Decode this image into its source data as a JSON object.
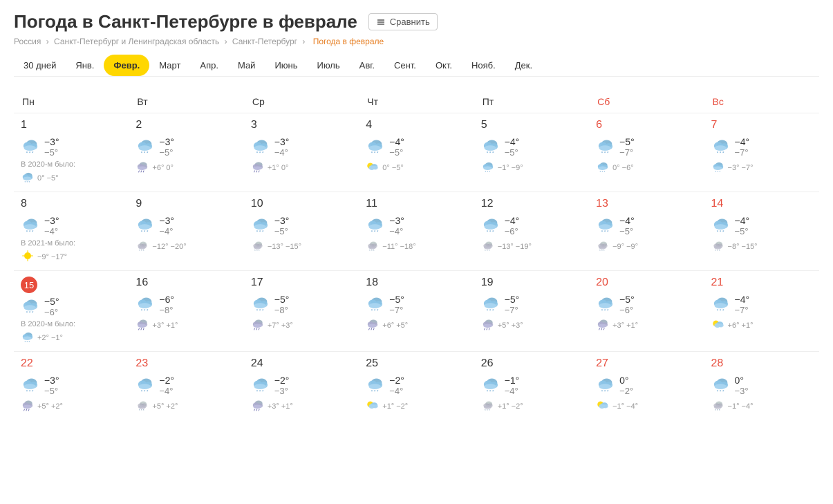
{
  "page": {
    "title": "Погода в Санкт-Петербурге в феврале",
    "compare_button": "Сравнить"
  },
  "breadcrumb": {
    "items": [
      "Россия",
      "Санкт-Петербург и Ленинградская область",
      "Санкт-Петербург"
    ],
    "current": "Погода в феврале"
  },
  "months": [
    {
      "label": "30 дней",
      "active": false
    },
    {
      "label": "Янв.",
      "active": false
    },
    {
      "label": "Февр.",
      "active": true
    },
    {
      "label": "Март",
      "active": false
    },
    {
      "label": "Апр.",
      "active": false
    },
    {
      "label": "Май",
      "active": false
    },
    {
      "label": "Июнь",
      "active": false
    },
    {
      "label": "Июль",
      "active": false
    },
    {
      "label": "Авг.",
      "active": false
    },
    {
      "label": "Сент.",
      "active": false
    },
    {
      "label": "Окт.",
      "active": false
    },
    {
      "label": "Нояб.",
      "active": false
    },
    {
      "label": "Дек.",
      "active": false
    }
  ],
  "weekdays": [
    {
      "label": "Пн",
      "weekend": false
    },
    {
      "label": "Вт",
      "weekend": false
    },
    {
      "label": "Ср",
      "weekend": false
    },
    {
      "label": "Чт",
      "weekend": false
    },
    {
      "label": "Пт",
      "weekend": false
    },
    {
      "label": "Сб",
      "weekend": true
    },
    {
      "label": "Вс",
      "weekend": true
    }
  ],
  "weeks": [
    {
      "days": [
        {
          "num": "1",
          "weekend": false,
          "icon": "snow-cloud",
          "high": "−3°",
          "low": "−5°",
          "was_label": "В 2020-м было:",
          "was_icon": "snow-cloud",
          "was_temps": "0° −5°"
        },
        {
          "num": "2",
          "weekend": false,
          "icon": "snow-cloud",
          "high": "−3°",
          "low": "−5°",
          "was_icon": "rain-cloud",
          "was_temps": "+6° 0°"
        },
        {
          "num": "3",
          "weekend": false,
          "icon": "snow-cloud",
          "high": "−3°",
          "low": "−4°",
          "was_icon": "rain-cloud",
          "was_temps": "+1° 0°"
        },
        {
          "num": "4",
          "weekend": false,
          "icon": "snow-cloud",
          "high": "−4°",
          "low": "−5°",
          "was_icon": "partly-sunny",
          "was_temps": "0° −5°"
        },
        {
          "num": "5",
          "weekend": false,
          "icon": "snow-cloud",
          "high": "−4°",
          "low": "−5°",
          "was_icon": "snow-cloud",
          "was_temps": "−1° −9°"
        },
        {
          "num": "6",
          "weekend": true,
          "icon": "snow-cloud",
          "high": "−5°",
          "low": "−7°",
          "was_icon": "snow-cloud",
          "was_temps": "0° −6°"
        },
        {
          "num": "7",
          "weekend": true,
          "icon": "snow-cloud",
          "high": "−4°",
          "low": "−7°",
          "was_icon": "snow-cloud",
          "was_temps": "−3° −7°"
        }
      ]
    },
    {
      "days": [
        {
          "num": "8",
          "weekend": false,
          "icon": "snow-cloud",
          "high": "−3°",
          "low": "−4°",
          "was_label": "В 2021-м было:",
          "was_icon": "sun",
          "was_temps": "−9° −17°"
        },
        {
          "num": "9",
          "weekend": false,
          "icon": "snow-cloud",
          "high": "−3°",
          "low": "−4°",
          "was_icon": "snow-cloud-small",
          "was_temps": "−12° −20°"
        },
        {
          "num": "10",
          "weekend": false,
          "icon": "snow-cloud",
          "high": "−3°",
          "low": "−5°",
          "was_icon": "snow-cloud-small",
          "was_temps": "−13° −15°"
        },
        {
          "num": "11",
          "weekend": false,
          "icon": "snow-cloud",
          "high": "−3°",
          "low": "−4°",
          "was_icon": "snow-cloud-small",
          "was_temps": "−11° −18°"
        },
        {
          "num": "12",
          "weekend": false,
          "icon": "snow-cloud",
          "high": "−4°",
          "low": "−6°",
          "was_icon": "snow-cloud-small",
          "was_temps": "−13° −19°"
        },
        {
          "num": "13",
          "weekend": true,
          "icon": "snow-cloud",
          "high": "−4°",
          "low": "−5°",
          "was_icon": "snow-cloud-small",
          "was_temps": "−9° −9°"
        },
        {
          "num": "14",
          "weekend": true,
          "icon": "snow-cloud",
          "high": "−4°",
          "low": "−5°",
          "was_icon": "snow-cloud-small",
          "was_temps": "−8° −15°"
        }
      ]
    },
    {
      "days": [
        {
          "num": "15",
          "weekend": false,
          "today": true,
          "icon": "snow-cloud",
          "high": "−5°",
          "low": "−6°",
          "was_label": "В 2020-м было:",
          "was_icon": "snow-cloud",
          "was_temps": "+2° −1°"
        },
        {
          "num": "16",
          "weekend": false,
          "icon": "snow-cloud",
          "high": "−6°",
          "low": "−8°",
          "was_icon": "rain-cloud",
          "was_temps": "+3° +1°"
        },
        {
          "num": "17",
          "weekend": false,
          "icon": "snow-cloud",
          "high": "−5°",
          "low": "−8°",
          "was_icon": "rain-cloud",
          "was_temps": "+7° +3°"
        },
        {
          "num": "18",
          "weekend": false,
          "icon": "snow-cloud",
          "high": "−5°",
          "low": "−7°",
          "was_icon": "rain-cloud",
          "was_temps": "+6° +5°"
        },
        {
          "num": "19",
          "weekend": false,
          "icon": "snow-cloud",
          "high": "−5°",
          "low": "−7°",
          "was_icon": "rain-cloud",
          "was_temps": "+5° +3°"
        },
        {
          "num": "20",
          "weekend": true,
          "icon": "snow-cloud",
          "high": "−5°",
          "low": "−6°",
          "was_icon": "rain-cloud",
          "was_temps": "+3° +1°"
        },
        {
          "num": "21",
          "weekend": true,
          "icon": "snow-cloud",
          "high": "−4°",
          "low": "−7°",
          "was_icon": "partly-sunny",
          "was_temps": "+6° +1°"
        }
      ]
    },
    {
      "days": [
        {
          "num": "22",
          "weekend": true,
          "icon": "snow-cloud",
          "high": "−3°",
          "low": "−5°",
          "was_icon": "rain-cloud",
          "was_temps": "+5° +2°"
        },
        {
          "num": "23",
          "weekend": true,
          "icon": "snow-cloud",
          "high": "−2°",
          "low": "−4°",
          "was_icon": "snow-cloud-small",
          "was_temps": "+5° +2°"
        },
        {
          "num": "24",
          "weekend": false,
          "icon": "snow-cloud",
          "high": "−2°",
          "low": "−3°",
          "was_icon": "rain-cloud",
          "was_temps": "+3° +1°"
        },
        {
          "num": "25",
          "weekend": false,
          "icon": "snow-cloud",
          "high": "−2°",
          "low": "−4°",
          "was_icon": "partly-sunny",
          "was_temps": "+1° −2°"
        },
        {
          "num": "26",
          "weekend": false,
          "icon": "snow-cloud",
          "high": "−1°",
          "low": "−4°",
          "was_icon": "snow-cloud-small",
          "was_temps": "+1° −2°"
        },
        {
          "num": "27",
          "weekend": true,
          "icon": "snow-cloud",
          "high": "0°",
          "low": "−2°",
          "was_icon": "partly-sunny",
          "was_temps": "−1° −4°"
        },
        {
          "num": "28",
          "weekend": true,
          "icon": "snow-cloud",
          "high": "0°",
          "low": "−3°",
          "was_icon": "snow-cloud-small",
          "was_temps": "−1° −4°"
        }
      ]
    }
  ]
}
